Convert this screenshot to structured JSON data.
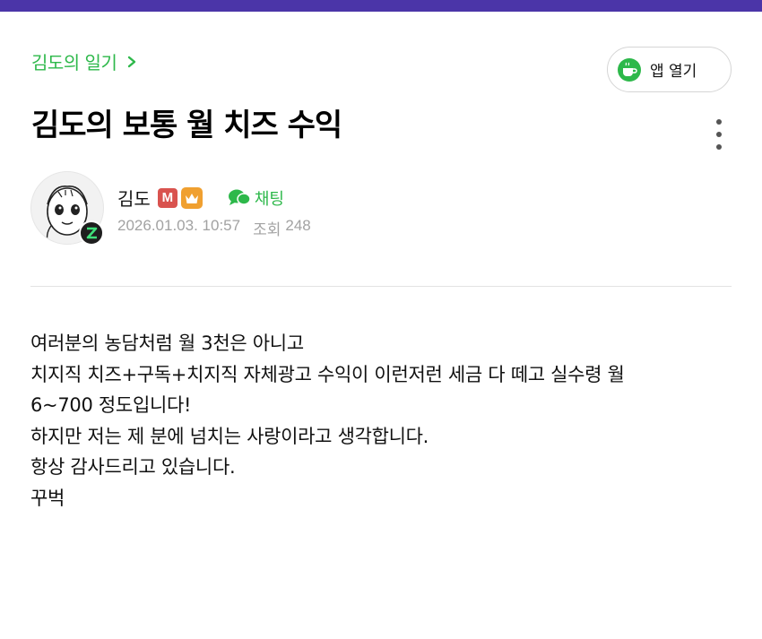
{
  "colors": {
    "accent_green": "#2db84a",
    "top_bar": "#4b35a8",
    "meta_gray": "#a2a2a2"
  },
  "header": {
    "cafe_name": "김도의 일기",
    "app_button_label": "앱 열기",
    "icons": {
      "chevron": "chevron-right-icon",
      "app": "cup-icon",
      "more": "more-vertical-icon"
    }
  },
  "post": {
    "title": "김도의 보통 월 치즈 수익",
    "author": {
      "name": "김도",
      "manager_badge": "M",
      "chat_label": "채팅"
    },
    "date": "2026.01.03. 10:57",
    "views_label": "조회",
    "views_count": "248",
    "body_lines": [
      "여러분의 농담처럼 월 3천은 아니고",
      "치지직 치즈+구독+치지직 자체광고 수익이 이런저런 세금 다 떼고 실수령 월",
      "6~700 정도입니다!",
      "하지만 저는 제 분에 넘치는 사랑이라고 생각합니다.",
      "항상 감사드리고 있습니다.",
      "꾸벅"
    ]
  }
}
